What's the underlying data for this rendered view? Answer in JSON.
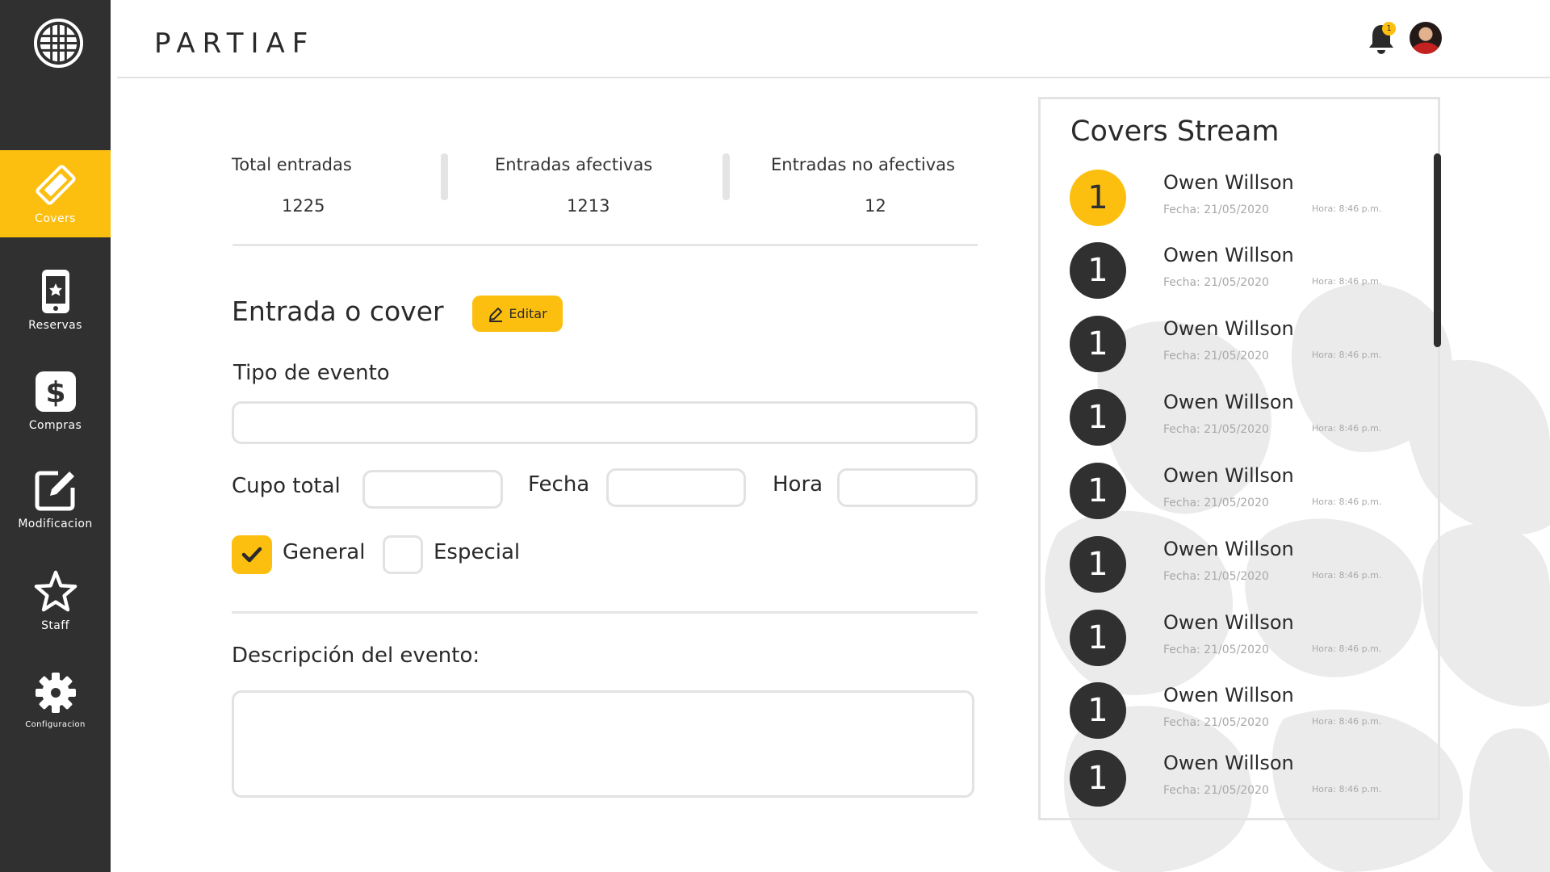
{
  "brand": {
    "name": "PARTIAF"
  },
  "sidebar": {
    "items": [
      {
        "label": "Covers",
        "icon": "ticket-icon",
        "active": true
      },
      {
        "label": "Reservas",
        "icon": "phone-star-icon",
        "active": false
      },
      {
        "label": "Compras",
        "icon": "dollar-icon",
        "active": false
      },
      {
        "label": "Modificacion",
        "icon": "edit-icon",
        "active": false
      },
      {
        "label": "Staff",
        "icon": "star-icon",
        "active": false
      },
      {
        "label": "Configuracion",
        "icon": "gear-icon",
        "active": false
      }
    ]
  },
  "header": {
    "notification_count": "1",
    "icons": [
      "bell-icon",
      "avatar"
    ]
  },
  "stats": [
    {
      "label": "Total entradas",
      "value": "1225"
    },
    {
      "label": "Entradas afectivas",
      "value": "1213"
    },
    {
      "label": "Entradas no afectivas",
      "value": "12"
    }
  ],
  "form": {
    "section_title": "Entrada o cover",
    "edit_label": "Editar",
    "tipo_evento_label": "Tipo de evento",
    "tipo_evento_value": "",
    "cupo_total_label": "Cupo total",
    "cupo_total_value": "",
    "fecha_label": "Fecha",
    "fecha_value": "",
    "hora_label": "Hora",
    "hora_value": "",
    "general_label": "General",
    "general_checked": true,
    "especial_label": "Especial",
    "especial_checked": false,
    "descripcion_label": "Descripción del evento:",
    "descripcion_value": ""
  },
  "stream": {
    "title": "Covers Stream",
    "items": [
      {
        "number": "1",
        "name": "Owen Willson",
        "date": "Fecha: 21/05/2020",
        "time": "Hora: 8:46 p.m.",
        "highlight": true
      },
      {
        "number": "1",
        "name": "Owen Willson",
        "date": "Fecha: 21/05/2020",
        "time": "Hora: 8:46 p.m.",
        "highlight": false
      },
      {
        "number": "1",
        "name": "Owen Willson",
        "date": "Fecha: 21/05/2020",
        "time": "Hora: 8:46 p.m.",
        "highlight": false
      },
      {
        "number": "1",
        "name": "Owen Willson",
        "date": "Fecha: 21/05/2020",
        "time": "Hora: 8:46 p.m.",
        "highlight": false
      },
      {
        "number": "1",
        "name": "Owen Willson",
        "date": "Fecha: 21/05/2020",
        "time": "Hora: 8:46 p.m.",
        "highlight": false
      },
      {
        "number": "1",
        "name": "Owen Willson",
        "date": "Fecha: 21/05/2020",
        "time": "Hora: 8:46 p.m.",
        "highlight": false
      },
      {
        "number": "1",
        "name": "Owen Willson",
        "date": "Fecha: 21/05/2020",
        "time": "Hora: 8:46 p.m.",
        "highlight": false
      },
      {
        "number": "1",
        "name": "Owen Willson",
        "date": "Fecha: 21/05/2020",
        "time": "Hora: 8:46 p.m.",
        "highlight": false
      },
      {
        "number": "1",
        "name": "Owen Willson",
        "date": "Fecha: 21/05/2020",
        "time": "Hora: 8:46 p.m.",
        "highlight": false
      }
    ]
  },
  "colors": {
    "accent": "#FDBF0F",
    "sidebar_bg": "#303030",
    "border": "#E2E2E2",
    "muted_text": "#A9A9A9"
  }
}
